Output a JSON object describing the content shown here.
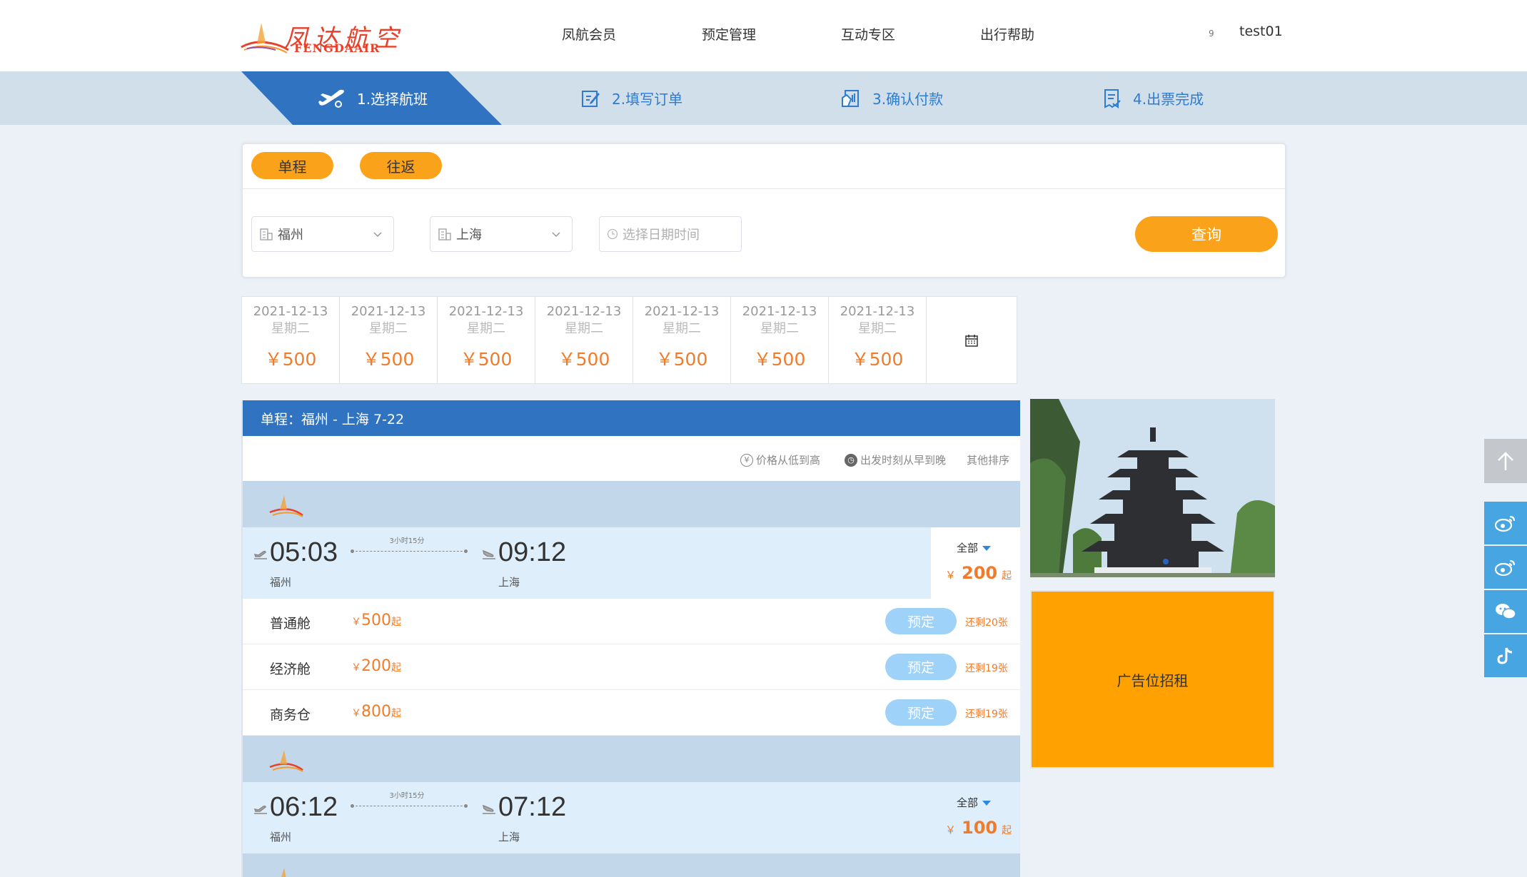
{
  "header": {
    "logo_text": "凤达航空",
    "logo_sub": "FENGDAAIR",
    "nav": [
      "凤航会员",
      "预定管理",
      "互动专区",
      "出行帮助"
    ],
    "user_marker": "9",
    "user_name": "test01"
  },
  "steps": [
    {
      "label": "1.选择航班",
      "icon": "airplane-takeoff-icon",
      "active": true
    },
    {
      "label": "2.填写订单",
      "icon": "edit-form-icon",
      "active": false
    },
    {
      "label": "3.确认付款",
      "icon": "payment-icon",
      "active": false
    },
    {
      "label": "4.出票完成",
      "icon": "ticket-done-icon",
      "active": false
    }
  ],
  "search": {
    "trip_one_way": "单程",
    "trip_round": "往返",
    "from_city": "福州",
    "to_city": "上海",
    "date_placeholder": "选择日期时间",
    "query_label": "查询"
  },
  "date_strip": [
    {
      "date": "2021-12-13",
      "weekday": "星期二",
      "price": "￥500"
    },
    {
      "date": "2021-12-13",
      "weekday": "星期二",
      "price": "￥500"
    },
    {
      "date": "2021-12-13",
      "weekday": "星期二",
      "price": "￥500"
    },
    {
      "date": "2021-12-13",
      "weekday": "星期二",
      "price": "￥500"
    },
    {
      "date": "2021-12-13",
      "weekday": "星期二",
      "price": "￥500"
    },
    {
      "date": "2021-12-13",
      "weekday": "星期二",
      "price": "￥500"
    },
    {
      "date": "2021-12-13",
      "weekday": "星期二",
      "price": "￥500"
    }
  ],
  "flight_panel": {
    "title": "单程：福州 - 上海   7-22",
    "sort_price": "价格从低到高",
    "sort_time": "出发时刻从早到晚",
    "sort_other": "其他排序",
    "flights": [
      {
        "depart_time": "05:03",
        "depart_city": "福州",
        "arrive_time": "09:12",
        "arrive_city": "上海",
        "duration": "3小时15分",
        "filter_label": "全部",
        "currency": "￥",
        "from_price": "200",
        "from_suffix": "起",
        "cabins": [
          {
            "name": "普通舱",
            "currency": "￥",
            "price": "500",
            "suffix": "起",
            "book": "预定",
            "remain": "还剩20张"
          },
          {
            "name": "经济舱",
            "currency": "￥",
            "price": "200",
            "suffix": "起",
            "book": "预定",
            "remain": "还剩19张"
          },
          {
            "name": "商务仓",
            "currency": "￥",
            "price": "800",
            "suffix": "起",
            "book": "预定",
            "remain": "还剩19张"
          }
        ]
      },
      {
        "depart_time": "06:12",
        "depart_city": "福州",
        "arrive_time": "07:12",
        "arrive_city": "上海",
        "duration": "3小时15分",
        "filter_label": "全部",
        "currency": "￥",
        "from_price": "100",
        "from_suffix": "起"
      }
    ]
  },
  "ad_label": "广告位招租",
  "side_buttons": [
    "back-to-top-icon",
    "weibo-icon",
    "weibo-icon",
    "wechat-icon",
    "tiktok-icon"
  ],
  "colors": {
    "primary_blue": "#3074c1",
    "orange": "#faa21a",
    "price_orange": "#f07b2b",
    "light_blue": "#dfeefb",
    "airline_bar": "#c2d8ea"
  }
}
